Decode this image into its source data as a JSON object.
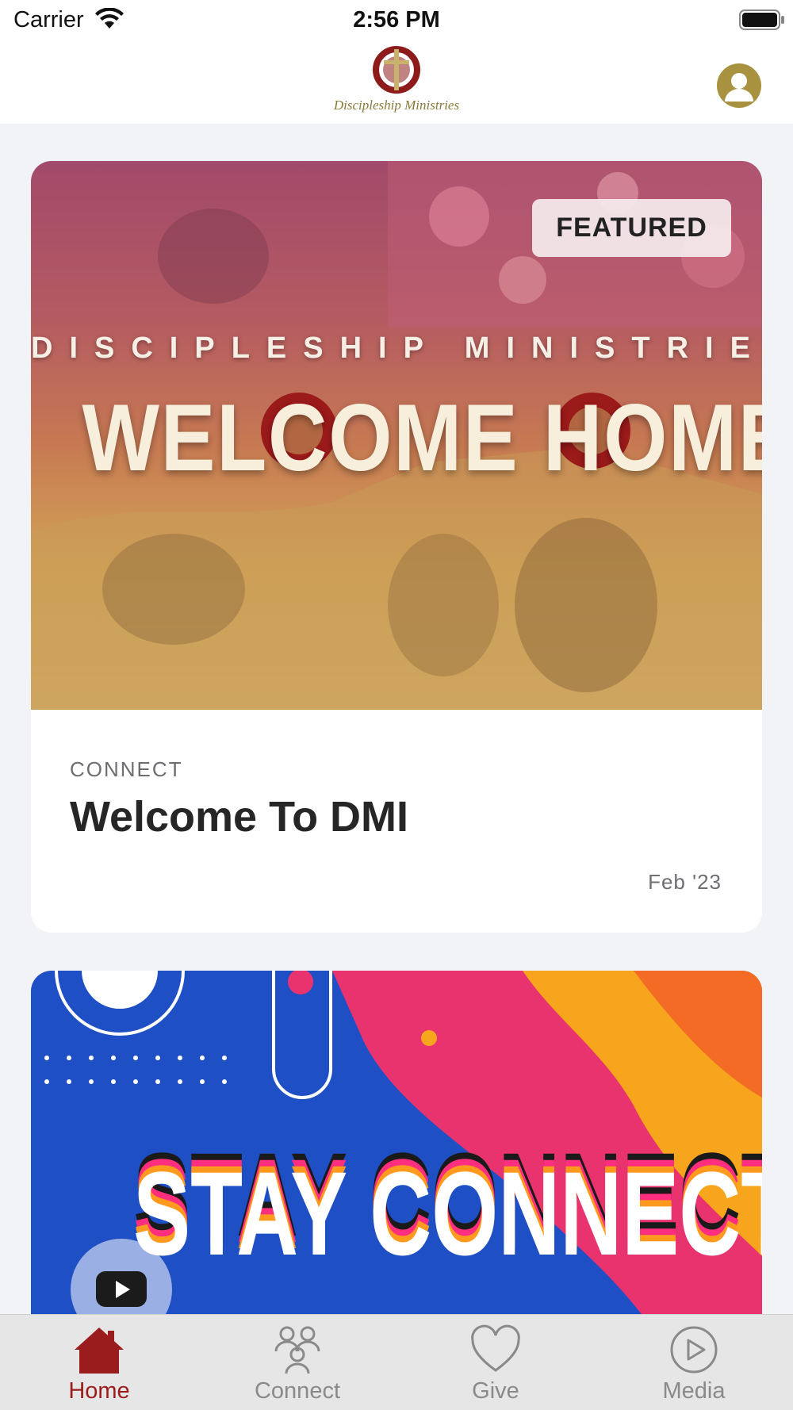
{
  "status_bar": {
    "carrier": "Carrier",
    "time": "2:56 PM"
  },
  "header": {
    "logo_text": "Discipleship Ministries",
    "avatar_icon": "user-avatar-icon"
  },
  "feed": [
    {
      "badge": "FEATURED",
      "image_tagline": "DISCIPLESHIP MINISTRIES",
      "image_title": "WELCOME HOME",
      "category": "CONNECT",
      "title": "Welcome To DMI",
      "date": "Feb '23"
    },
    {
      "image_title": "STAY CONNECTED",
      "video_icon": "youtube-play-icon"
    }
  ],
  "tabs": [
    {
      "label": "Home",
      "icon": "home-icon",
      "active": true
    },
    {
      "label": "Connect",
      "icon": "people-icon",
      "active": false
    },
    {
      "label": "Give",
      "icon": "heart-icon",
      "active": false
    },
    {
      "label": "Media",
      "icon": "play-circle-icon",
      "active": false
    }
  ],
  "colors": {
    "accent": "#9b1c1c",
    "avatar": "#a8923f",
    "background": "#f2f3f7",
    "tab_inactive": "#8a8a8a"
  }
}
